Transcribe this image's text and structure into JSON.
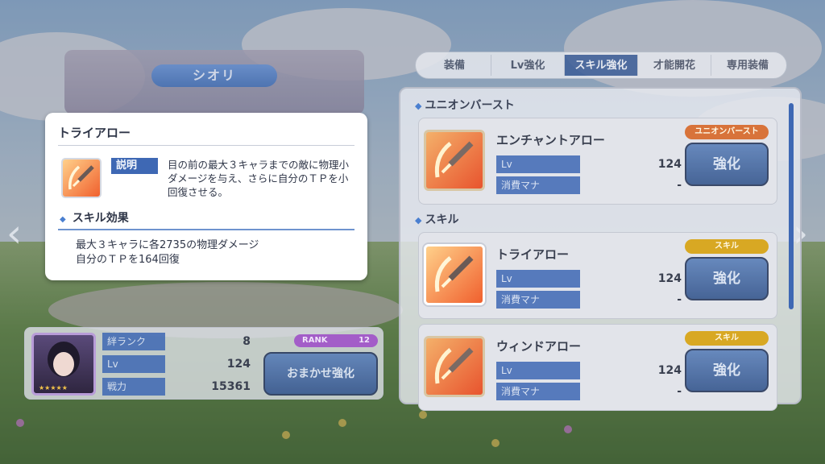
{
  "character": {
    "name": "シオリ"
  },
  "tabs": [
    "装備",
    "Lv強化",
    "スキル強化",
    "才能開花",
    "専用装備"
  ],
  "active_tab": "スキル強化",
  "sections": {
    "union_burst": "ユニオンバースト",
    "skill": "スキル"
  },
  "skills": [
    {
      "name": "エンチャントアロー",
      "badge": "ユニオンバースト",
      "lv_label": "Lv",
      "lv": "124",
      "mana_label": "消費マナ",
      "mana": "-",
      "button": "強化"
    },
    {
      "name": "トライアロー",
      "badge": "スキル",
      "lv_label": "Lv",
      "lv": "124",
      "mana_label": "消費マナ",
      "mana": "-",
      "button": "強化"
    },
    {
      "name": "ウィンドアロー",
      "badge": "スキル",
      "lv_label": "Lv",
      "lv": "124",
      "mana_label": "消費マナ",
      "mana": "-",
      "button": "強化"
    }
  ],
  "status": {
    "bond_label": "絆ランク",
    "bond": "8",
    "lv_label": "Lv",
    "lv": "124",
    "power_label": "戦力",
    "power": "15361",
    "rank_label": "RANK",
    "rank": "12",
    "auto_button": "おまかせ強化"
  },
  "popup": {
    "title": "トライアロー",
    "desc_label": "説明",
    "description": "目の前の最大３キャラまでの敵に物理小ダメージを与え、さらに自分のＴＰを小回復させる。",
    "effect_title": "スキル効果",
    "effect_line1": "最大３キャラに各2735の物理ダメージ",
    "effect_line2": "自分のＴＰを164回復"
  },
  "icons": {
    "prev": "chevron-left-icon",
    "next": "chevron-right-icon",
    "skill": "bow-arrow-icon"
  },
  "colors": {
    "accent": "#3e68b4",
    "union_badge": "#d8733a",
    "skill_badge": "#d8a823",
    "rank_badge": "#a35dc8"
  }
}
